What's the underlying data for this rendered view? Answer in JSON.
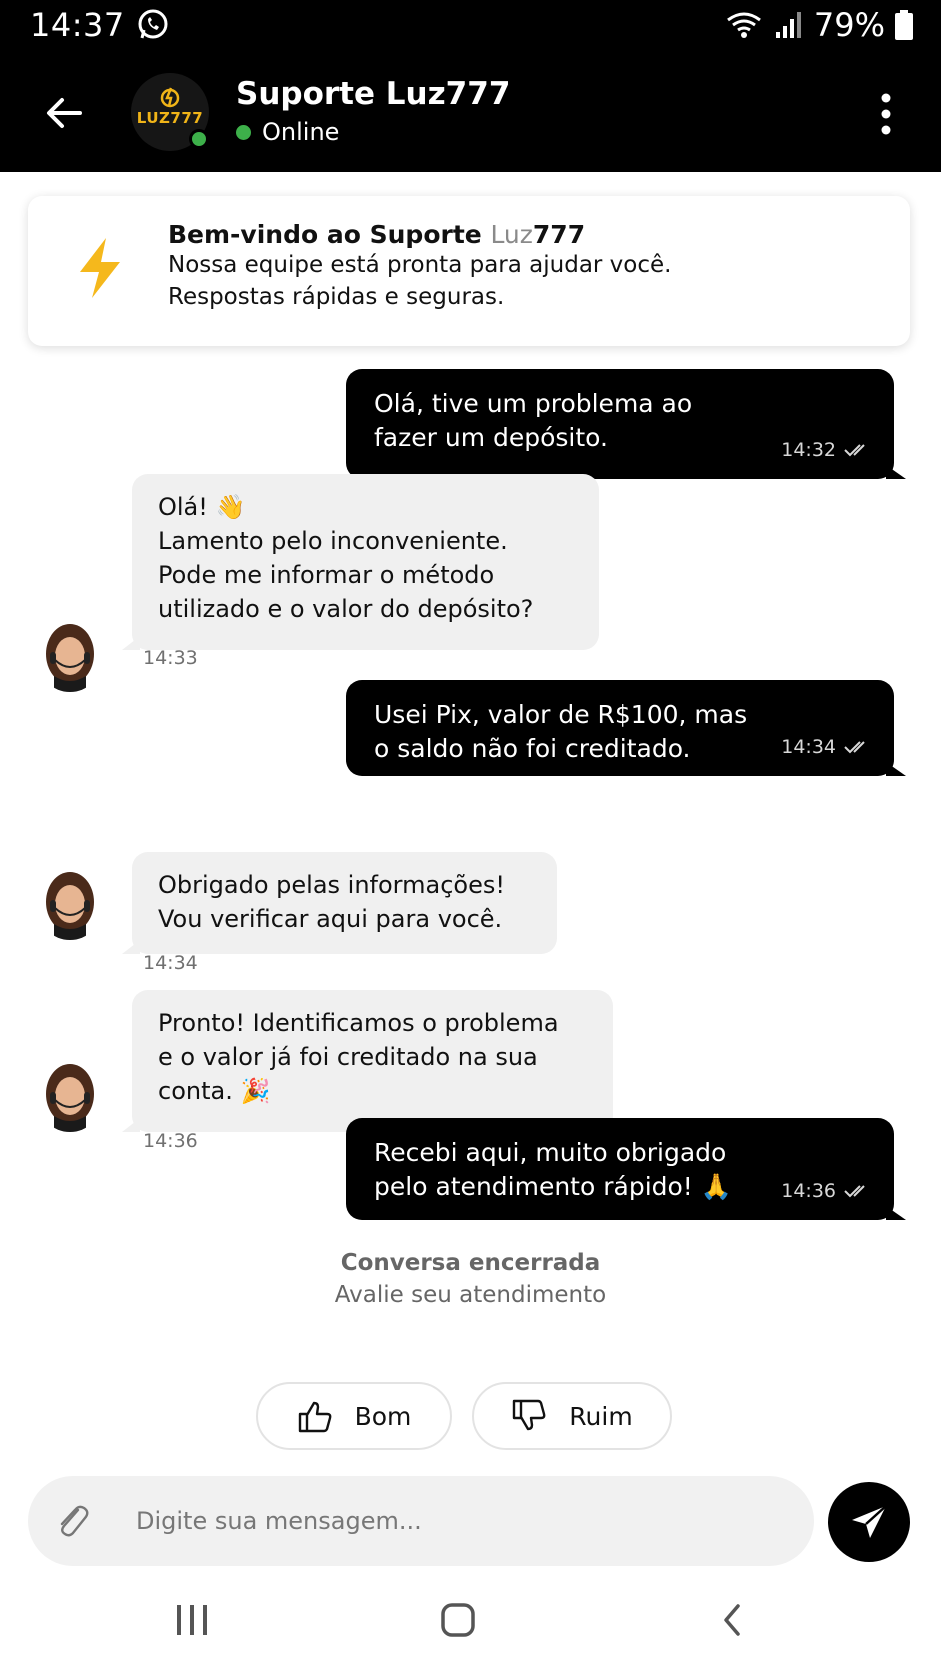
{
  "status_bar": {
    "time": "14:37",
    "battery_pct": "79%"
  },
  "header": {
    "logo_text": "LUZ777",
    "title": "Suporte Luz777",
    "status": "Online"
  },
  "welcome": {
    "title_a": "Bem-vindo ao Suporte ",
    "title_b": "Luz",
    "title_c": "777",
    "line1": "Nossa equipe está pronta para ajudar você.",
    "line2": "Respostas rápidas e seguras."
  },
  "messages": [
    {
      "from": "user",
      "lines": [
        "Olá, tive um problema ao",
        "fazer um depósito."
      ],
      "time": "14:32"
    },
    {
      "from": "agent",
      "lines": [
        "Olá! 👋",
        "Lamento pelo inconveniente.",
        "Pode me informar o método",
        "utilizado e o valor do depósito?"
      ],
      "time": "14:33"
    },
    {
      "from": "user",
      "lines": [
        "Usei Pix, valor de R$100, mas",
        "o saldo não foi creditado."
      ],
      "time": "14:34"
    },
    {
      "from": "agent",
      "lines": [
        "Obrigado pelas informações!",
        "Vou verificar aqui para você."
      ],
      "time": "14:34"
    },
    {
      "from": "agent",
      "lines": [
        "Pronto! Identificamos o problema",
        "e o valor já foi creditado na sua",
        "conta. 🎉"
      ],
      "time": "14:36"
    },
    {
      "from": "user",
      "lines": [
        "Recebi aqui, muito obrigado",
        "pelo atendimento rápido! 🙏"
      ],
      "time": "14:36"
    }
  ],
  "closed": {
    "title": "Conversa encerrada",
    "subtitle": "Avalie seu atendimento"
  },
  "rating": {
    "good_label": "Bom",
    "bad_label": "Ruim"
  },
  "composer": {
    "placeholder": "Digite sua mensagem..."
  },
  "colors": {
    "accent": "#000000",
    "online": "#3db04a",
    "logo_gold": "#f0b418",
    "bolt": "#f5b81c",
    "incoming_bubble": "#f0f0f0"
  }
}
